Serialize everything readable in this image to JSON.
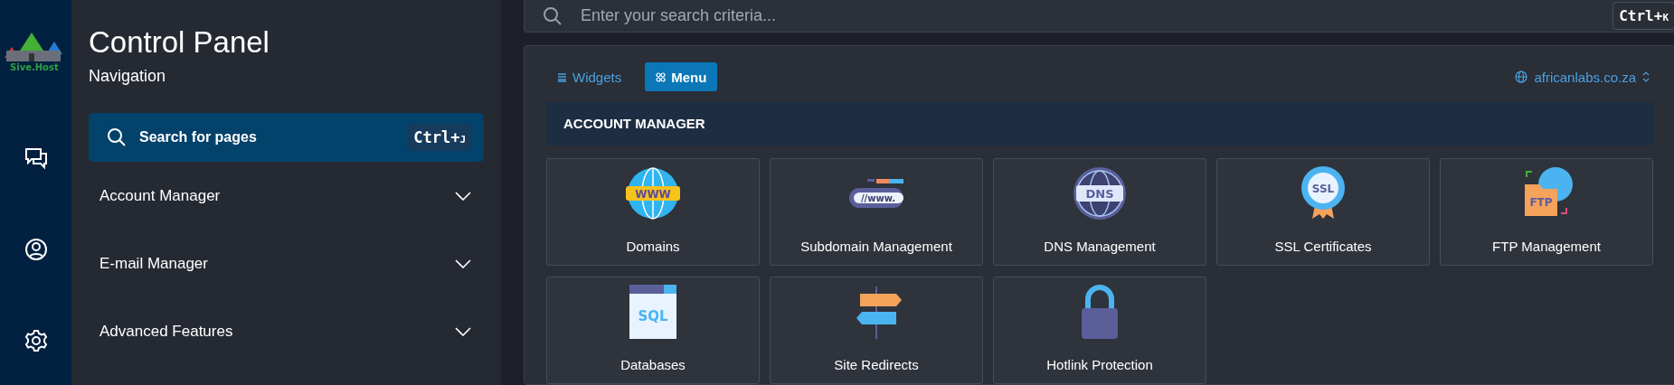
{
  "logo": {
    "text": "Sive.Host"
  },
  "rail": [
    {
      "kind": "chat"
    },
    {
      "kind": "user"
    },
    {
      "kind": "settings"
    }
  ],
  "sidebar": {
    "title": "Control Panel",
    "subtitle": "Navigation",
    "search": {
      "placeholder": "Search for pages",
      "shortcut_main": "Ctrl+",
      "shortcut_key": "J"
    },
    "items": [
      {
        "label": "Account Manager",
        "expanded": false
      },
      {
        "label": "E-mail Manager",
        "expanded": false
      },
      {
        "label": "Advanced Features",
        "expanded": false
      }
    ]
  },
  "top_search": {
    "placeholder": "Enter your search criteria...",
    "shortcut_main": "Ctrl+",
    "shortcut_key": "K"
  },
  "tabs": [
    {
      "label": "Widgets",
      "kind": "list",
      "selected": false
    },
    {
      "label": "Menu",
      "kind": "grid",
      "selected": true
    }
  ],
  "domain": "africanlabs.co.za",
  "section": {
    "title": "ACCOUNT MANAGER",
    "tiles": [
      {
        "label": "Domains",
        "kind": "globe",
        "icon_text": "WWW"
      },
      {
        "label": "Subdomain Management",
        "kind": "address",
        "icon_text": "//www."
      },
      {
        "label": "DNS Management",
        "kind": "dns",
        "icon_text": "DNS"
      },
      {
        "label": "SSL Certificates",
        "kind": "badge",
        "icon_text": "SSL"
      },
      {
        "label": "FTP Management",
        "kind": "folder",
        "icon_text": "FTP"
      },
      {
        "label": "Databases",
        "kind": "sql",
        "icon_text": "SQL"
      },
      {
        "label": "Site Redirects",
        "kind": "signpost"
      },
      {
        "label": "Hotlink Protection",
        "kind": "lock"
      }
    ]
  }
}
